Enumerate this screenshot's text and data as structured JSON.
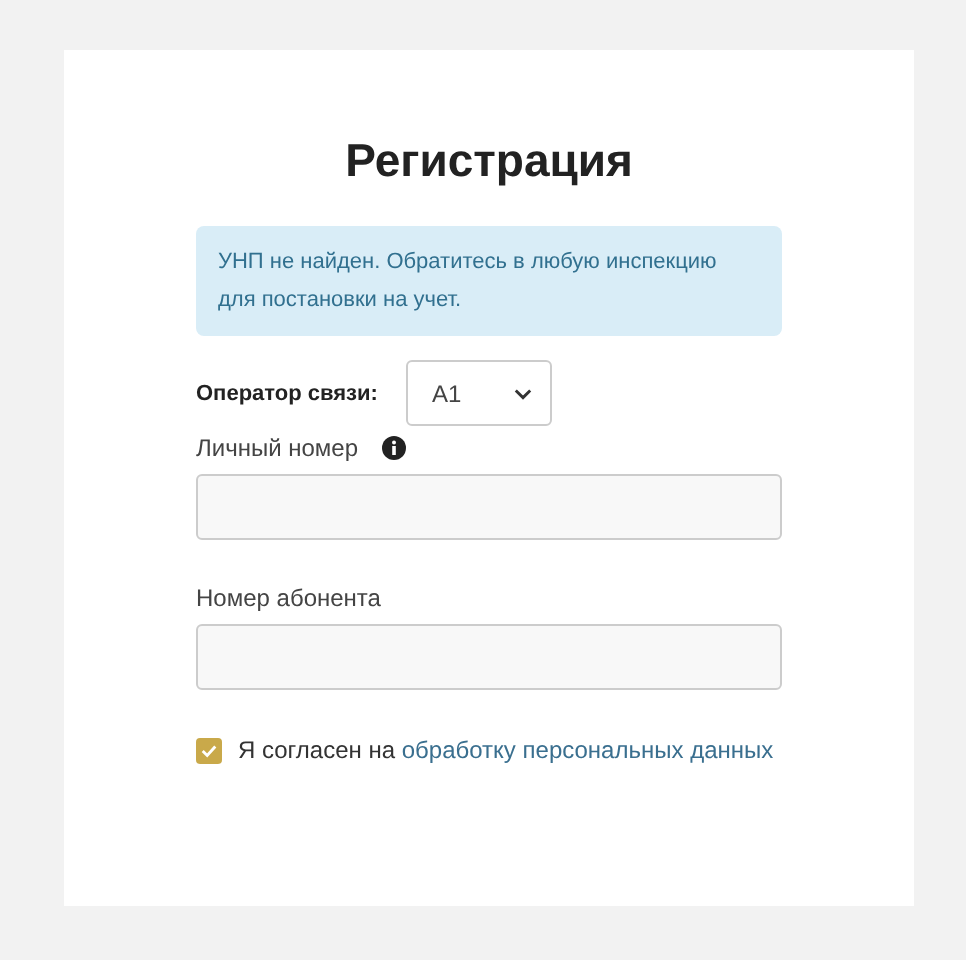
{
  "title": "Регистрация",
  "alert": "УНП не найден. Обратитесь в любую инспекцию для постановки на учет.",
  "operator": {
    "label": "Оператор связи:",
    "value": "А1"
  },
  "fields": [
    {
      "label": "Личный номер",
      "info": true
    },
    {
      "label": "Номер абонента",
      "info": false
    }
  ],
  "consent": {
    "checked": true,
    "text": "Я согласен на ",
    "link": "обработку персональных данных"
  }
}
